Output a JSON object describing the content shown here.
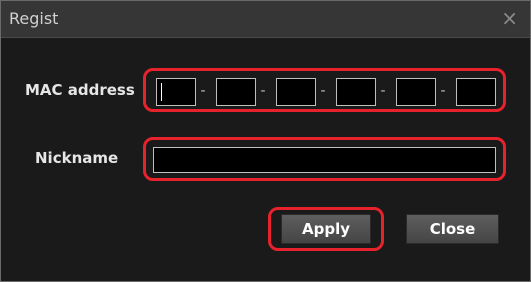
{
  "dialog": {
    "title": "Regist",
    "close_icon": "×"
  },
  "form": {
    "mac_label": "MAC address",
    "mac_fields": [
      "",
      "",
      "",
      "",
      "",
      ""
    ],
    "mac_separator": "-",
    "nickname_label": "Nickname",
    "nickname_value": ""
  },
  "buttons": {
    "apply_label": "Apply",
    "close_label": "Close"
  },
  "colors": {
    "highlight": "#e8222d",
    "background": "#1a1a1a",
    "titlebar": "#363636"
  }
}
